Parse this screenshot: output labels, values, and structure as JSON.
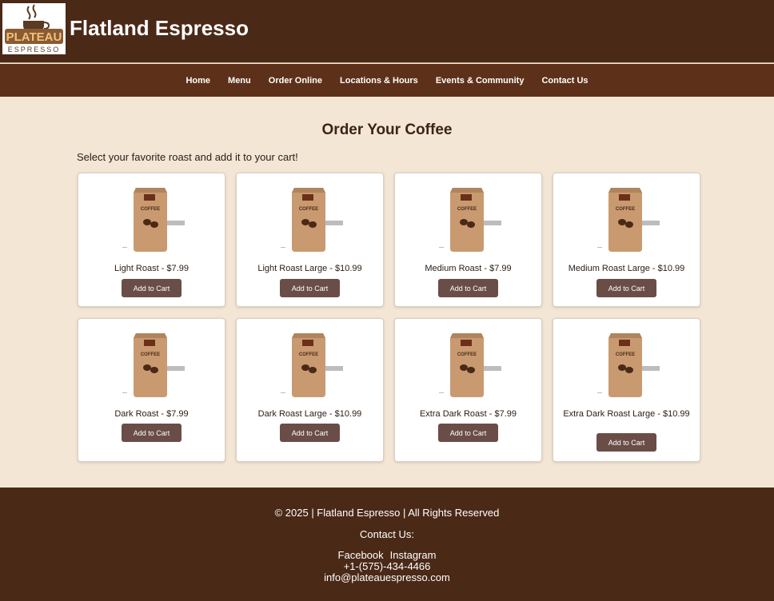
{
  "header": {
    "brand_title": "Flatland Espresso",
    "logo": {
      "top_word": "PLATEAU",
      "bottom_word": "ESPRESSO"
    }
  },
  "nav": {
    "items": [
      "Home",
      "Menu",
      "Order Online",
      "Locations & Hours",
      "Events & Community",
      "Contact Us"
    ]
  },
  "main": {
    "title": "Order Your Coffee",
    "intro": "Select your favorite roast and add it to your cart!",
    "products": [
      {
        "name": "Light Roast - $7.99",
        "button": "Add to Cart"
      },
      {
        "name": "Light Roast Large - $10.99",
        "button": "Add to Cart"
      },
      {
        "name": "Medium Roast - $7.99",
        "button": "Add to Cart"
      },
      {
        "name": "Medium Roast Large - $10.99",
        "button": "Add to Cart"
      },
      {
        "name": "Dark Roast - $7.99",
        "button": "Add to Cart"
      },
      {
        "name": "Dark Roast Large - $10.99",
        "button": "Add to Cart"
      },
      {
        "name": "Extra Dark Roast - $7.99",
        "button": "Add to Cart"
      },
      {
        "name": "Extra Dark Roast Large - $10.99",
        "button": "Add to Cart"
      }
    ],
    "bag_label": "COFFEE"
  },
  "footer": {
    "copyright": "© 2025 | Flatland Espresso | All Rights Reserved",
    "contact_label": "Contact Us:",
    "facebook": "Facebook",
    "instagram": "Instagram",
    "phone": "+1-(575)-434-4466",
    "email": "info@plateauespresso.com"
  },
  "colors": {
    "header_bg": "#4a2917",
    "nav_bg": "#5d3119",
    "page_bg": "#f4e6d4",
    "button_bg": "#6b4d47"
  }
}
